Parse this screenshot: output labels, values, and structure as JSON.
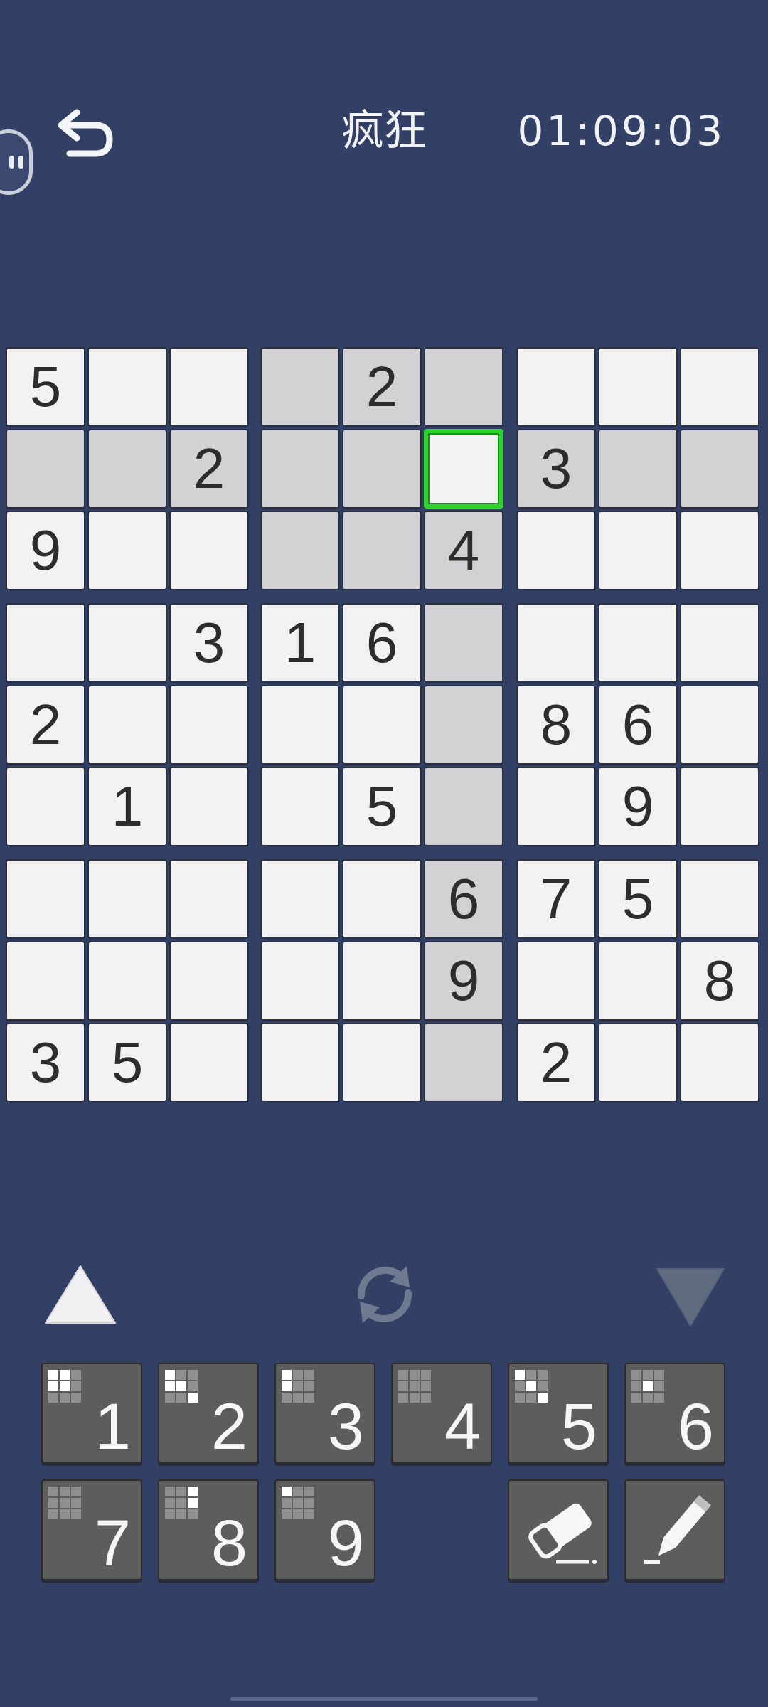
{
  "header": {
    "title": "疯狂",
    "timer": "01:09:03"
  },
  "board": {
    "rows": [
      [
        "5",
        "",
        "",
        "",
        "2",
        "",
        "",
        "",
        ""
      ],
      [
        "",
        "",
        "2",
        "",
        "",
        "",
        "3",
        "",
        ""
      ],
      [
        "9",
        "",
        "",
        "",
        "",
        "4",
        "",
        "",
        ""
      ],
      [
        "",
        "",
        "3",
        "1",
        "6",
        "",
        "",
        "",
        ""
      ],
      [
        "2",
        "",
        "",
        "",
        "",
        "",
        "8",
        "6",
        ""
      ],
      [
        "",
        "1",
        "",
        "",
        "5",
        "",
        "",
        "9",
        ""
      ],
      [
        "",
        "",
        "",
        "",
        "",
        "6",
        "7",
        "5",
        ""
      ],
      [
        "",
        "",
        "",
        "",
        "",
        "9",
        "",
        "",
        "8"
      ],
      [
        "3",
        "5",
        "",
        "",
        "",
        "",
        "2",
        "",
        ""
      ]
    ],
    "selected": {
      "row": 1,
      "col": 5
    },
    "highlighted": [
      [
        0,
        3
      ],
      [
        0,
        4
      ],
      [
        0,
        5
      ],
      [
        1,
        0
      ],
      [
        1,
        1
      ],
      [
        1,
        2
      ],
      [
        1,
        3
      ],
      [
        1,
        4
      ],
      [
        1,
        6
      ],
      [
        1,
        7
      ],
      [
        1,
        8
      ],
      [
        2,
        3
      ],
      [
        2,
        4
      ],
      [
        2,
        5
      ],
      [
        3,
        5
      ],
      [
        4,
        5
      ],
      [
        5,
        5
      ],
      [
        6,
        5
      ],
      [
        7,
        5
      ],
      [
        8,
        5
      ]
    ]
  },
  "controls": {
    "up_icon": "triangle-up-icon",
    "refresh_icon": "refresh-icon",
    "down_icon": "triangle-down-icon"
  },
  "numpad": {
    "keys": [
      {
        "label": "1",
        "mini": [
          1,
          1,
          0,
          1,
          1,
          0,
          0,
          0,
          0
        ]
      },
      {
        "label": "2",
        "mini": [
          1,
          0,
          0,
          1,
          1,
          0,
          0,
          0,
          1
        ]
      },
      {
        "label": "3",
        "mini": [
          1,
          0,
          0,
          1,
          0,
          0,
          0,
          0,
          0
        ]
      },
      {
        "label": "4",
        "mini": [
          0,
          0,
          0,
          0,
          0,
          0,
          0,
          0,
          0
        ]
      },
      {
        "label": "5",
        "mini": [
          1,
          0,
          0,
          0,
          1,
          0,
          0,
          0,
          1
        ]
      },
      {
        "label": "6",
        "mini": [
          0,
          0,
          0,
          0,
          1,
          0,
          0,
          0,
          0
        ]
      },
      {
        "label": "7",
        "mini": [
          0,
          0,
          0,
          0,
          0,
          0,
          0,
          0,
          0
        ]
      },
      {
        "label": "8",
        "mini": [
          0,
          0,
          1,
          0,
          0,
          1,
          0,
          0,
          0
        ]
      },
      {
        "label": "9",
        "mini": [
          1,
          0,
          0,
          0,
          0,
          0,
          0,
          0,
          0
        ]
      }
    ],
    "eraser_icon": "eraser-icon",
    "pencil_icon": "pencil-icon"
  },
  "colors": {
    "background": "#334066",
    "cell": "#f3f2f3",
    "highlight": "#d2d2d4",
    "selected_border": "#2fd22f",
    "key": "#5d5d5d"
  }
}
